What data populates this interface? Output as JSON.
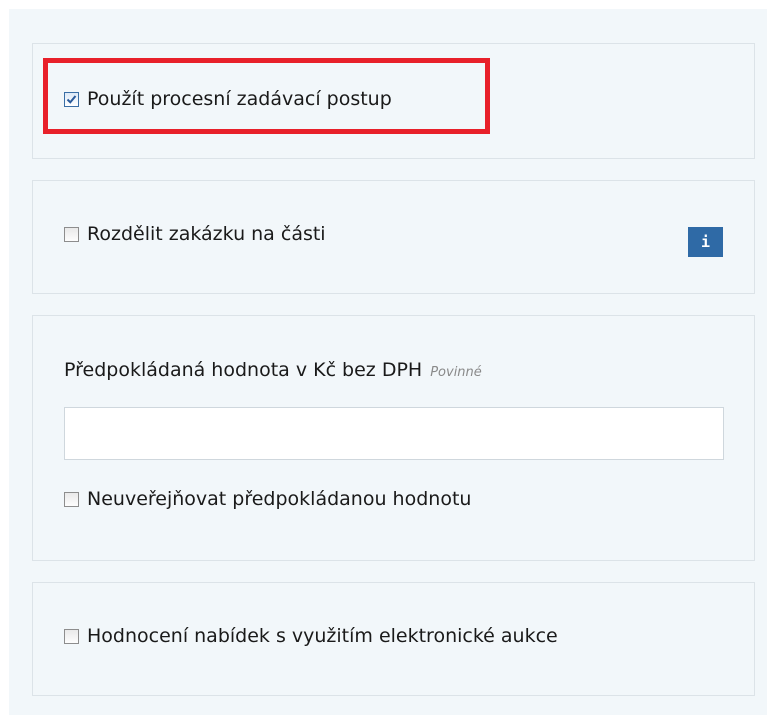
{
  "form": {
    "procedure": {
      "label": "Použít procesní zadávací postup",
      "checked": true
    },
    "split": {
      "label": "Rozdělit zakázku na části",
      "checked": false,
      "info_button_label": "i"
    },
    "estimated_value": {
      "label": "Předpokládaná hodnota v Kč bez DPH",
      "required_label": "Povinné",
      "value": "",
      "hide_label": "Neuveřejňovat předpokládanou hodnotu",
      "hide_checked": false
    },
    "auction": {
      "label": "Hodnocení nabídek s využitím elektronické aukce",
      "checked": false
    }
  },
  "colors": {
    "panel_background": "#f2f7fa",
    "panel_border": "#dce3e8",
    "highlight_border": "#e8202a",
    "info_button": "#2f6aa6"
  }
}
